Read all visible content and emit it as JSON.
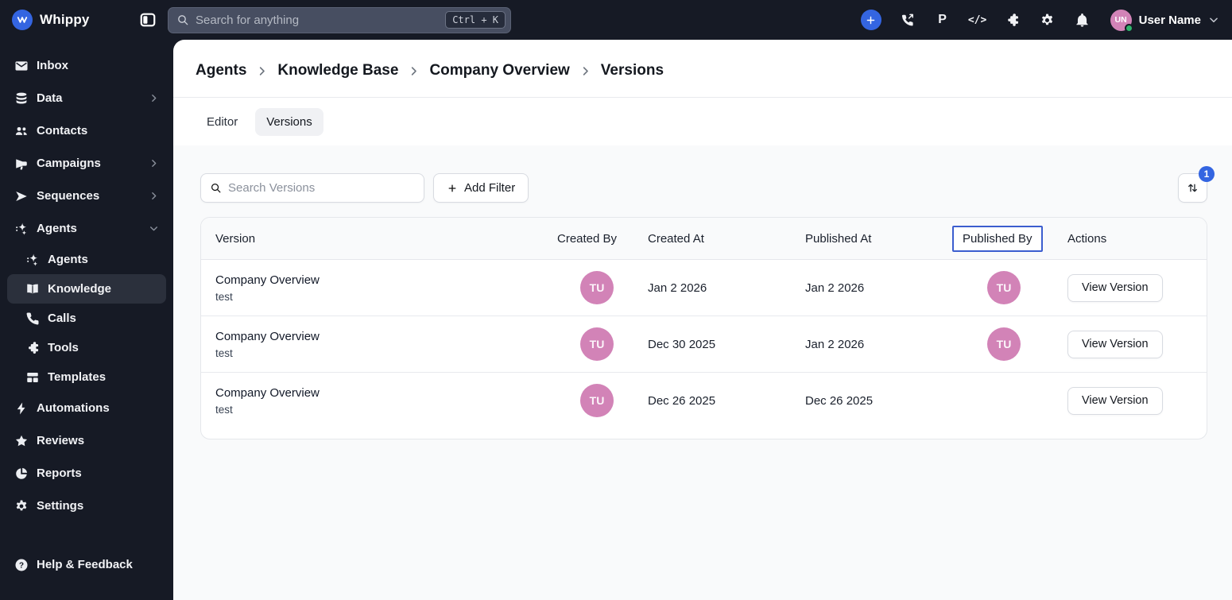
{
  "topbar": {
    "brand_name": "Whippy",
    "search": {
      "placeholder": "Search for anything",
      "shortcut": "Ctrl + K"
    },
    "icons": {
      "p_label": "P",
      "code_label": "</>"
    },
    "user": {
      "initials": "UN",
      "name": "User Name"
    }
  },
  "sidebar": {
    "items_top": [
      {
        "label": "Inbox"
      },
      {
        "label": "Data"
      },
      {
        "label": "Contacts"
      },
      {
        "label": "Campaigns"
      },
      {
        "label": "Sequences"
      },
      {
        "label": "Agents"
      }
    ],
    "agents_children": [
      {
        "label": "Agents"
      },
      {
        "label": "Knowledge"
      },
      {
        "label": "Calls"
      },
      {
        "label": "Tools"
      },
      {
        "label": "Templates"
      }
    ],
    "items_bottom": [
      {
        "label": "Automations"
      },
      {
        "label": "Reviews"
      },
      {
        "label": "Reports"
      },
      {
        "label": "Settings"
      }
    ],
    "footer": {
      "label": "Help & Feedback"
    }
  },
  "breadcrumb": [
    "Agents",
    "Knowledge Base",
    "Company Overview",
    "Versions"
  ],
  "tabs": [
    {
      "label": "Editor"
    },
    {
      "label": "Versions"
    }
  ],
  "toolbar": {
    "search_placeholder": "Search Versions",
    "add_filter_label": "Add Filter",
    "sort_badge": "1"
  },
  "table": {
    "columns": [
      "Version",
      "Created By",
      "Created At",
      "Published At",
      "Published By",
      "Actions"
    ],
    "highlighted_column": "Published By",
    "action_label": "View Version",
    "rows": [
      {
        "name": "Company Overview",
        "description": "test",
        "created_by_initials": "TU",
        "created_at": "Jan 2 2026",
        "published_at": "Jan 2 2026",
        "published_by_initials": "TU"
      },
      {
        "name": "Company Overview",
        "description": "test",
        "created_by_initials": "TU",
        "created_at": "Dec 30 2025",
        "published_at": "Jan 2 2026",
        "published_by_initials": "TU"
      },
      {
        "name": "Company Overview",
        "description": "test",
        "created_by_initials": "TU",
        "created_at": "Dec 26 2025",
        "published_at": "Dec 26 2025",
        "published_by_initials": ""
      }
    ]
  },
  "colors": {
    "topbar_bg": "#161a25",
    "accent_blue": "#3465e1",
    "avatar_pink": "#d283b7",
    "online_green": "#2fb46c",
    "focus_ring_blue": "#3c5ecf"
  }
}
